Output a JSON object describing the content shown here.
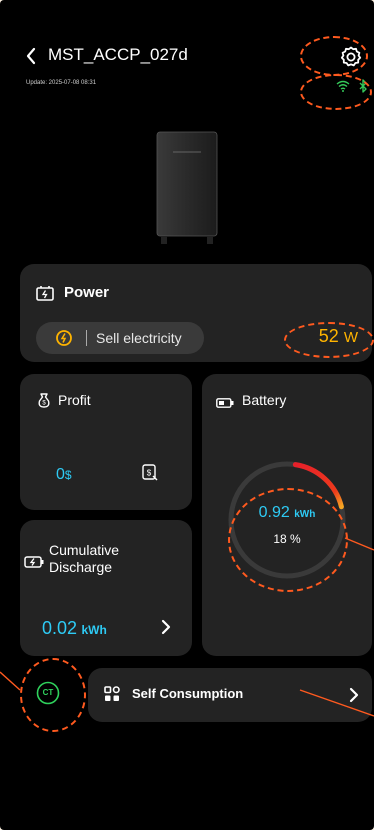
{
  "header": {
    "title": "MST_ACCP_027d",
    "update": "Update: 2025-07-08 08:31"
  },
  "power": {
    "title": "Power",
    "mode": "Sell electricity",
    "value": "52",
    "unit": "W"
  },
  "profit": {
    "title": "Profit",
    "value": "0",
    "unit": "$"
  },
  "battery": {
    "title": "Battery",
    "energy": "0.92",
    "energy_unit": "kWh",
    "percent": "18 %",
    "level": 0.18
  },
  "cumulative": {
    "title_line1": "Cumulative",
    "title_line2": "Discharge",
    "value": "0.02",
    "unit": "kWh"
  },
  "ct": {
    "label": "CT"
  },
  "self_consumption": {
    "label": "Self Consumption"
  },
  "colors": {
    "accent": "#2ecbf5",
    "power_value": "#ffb400",
    "ct_green": "#2fd25c",
    "annotation": "#ff5a1f",
    "wifi": "#34c759",
    "bluetooth": "#34c759"
  }
}
